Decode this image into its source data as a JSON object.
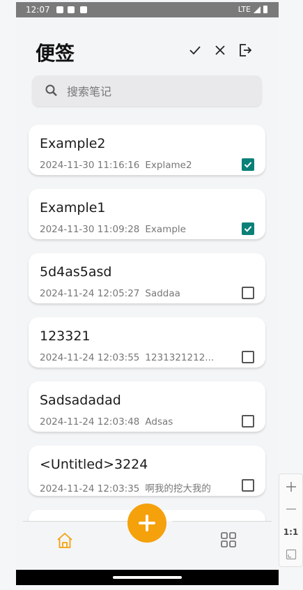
{
  "status_bar": {
    "time": "12:07",
    "network": "LTE"
  },
  "header": {
    "title": "便签",
    "icons": [
      "check-icon",
      "close-icon",
      "logout-icon"
    ]
  },
  "search": {
    "placeholder": "搜索笔记",
    "value": ""
  },
  "notes": [
    {
      "title": "Example2",
      "date": "2024-11-30 11:16:16",
      "preview": "Explame2",
      "checked": true
    },
    {
      "title": "Example1",
      "date": "2024-11-30 11:09:28",
      "preview": "Example",
      "checked": true
    },
    {
      "title": "5d4as5asd",
      "date": "2024-11-24 12:05:27",
      "preview": "Saddaa",
      "checked": false
    },
    {
      "title": "123321",
      "date": "2024-11-24 12:03:55",
      "preview": "1231321212...",
      "checked": false
    },
    {
      "title": "Sadsadadad",
      "date": "2024-11-24 12:03:48",
      "preview": "Adsas",
      "checked": false
    },
    {
      "title": "<Untitled>3224",
      "date": "2024-11-24 12:03:35",
      "preview": "啊我的挖大我的",
      "checked": false
    }
  ],
  "bottom_nav": {
    "home_icon": "home-icon",
    "add_icon": "plus-icon",
    "grid_icon": "grid-icon"
  },
  "zoom_panel": {
    "actual_size_label": "1:1"
  },
  "colors": {
    "accent": "#f5a10c",
    "checkbox_checked": "#0b8078"
  }
}
